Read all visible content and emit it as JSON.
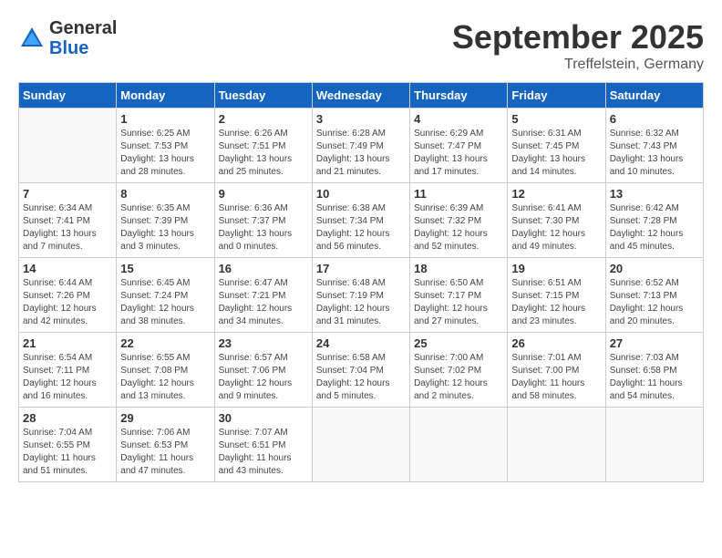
{
  "header": {
    "logo": {
      "general": "General",
      "blue": "Blue"
    },
    "title": "September 2025",
    "subtitle": "Treffelstein, Germany"
  },
  "days_of_week": [
    "Sunday",
    "Monday",
    "Tuesday",
    "Wednesday",
    "Thursday",
    "Friday",
    "Saturday"
  ],
  "weeks": [
    [
      {
        "day": "",
        "info": ""
      },
      {
        "day": "1",
        "info": "Sunrise: 6:25 AM\nSunset: 7:53 PM\nDaylight: 13 hours\nand 28 minutes."
      },
      {
        "day": "2",
        "info": "Sunrise: 6:26 AM\nSunset: 7:51 PM\nDaylight: 13 hours\nand 25 minutes."
      },
      {
        "day": "3",
        "info": "Sunrise: 6:28 AM\nSunset: 7:49 PM\nDaylight: 13 hours\nand 21 minutes."
      },
      {
        "day": "4",
        "info": "Sunrise: 6:29 AM\nSunset: 7:47 PM\nDaylight: 13 hours\nand 17 minutes."
      },
      {
        "day": "5",
        "info": "Sunrise: 6:31 AM\nSunset: 7:45 PM\nDaylight: 13 hours\nand 14 minutes."
      },
      {
        "day": "6",
        "info": "Sunrise: 6:32 AM\nSunset: 7:43 PM\nDaylight: 13 hours\nand 10 minutes."
      }
    ],
    [
      {
        "day": "7",
        "info": "Sunrise: 6:34 AM\nSunset: 7:41 PM\nDaylight: 13 hours\nand 7 minutes."
      },
      {
        "day": "8",
        "info": "Sunrise: 6:35 AM\nSunset: 7:39 PM\nDaylight: 13 hours\nand 3 minutes."
      },
      {
        "day": "9",
        "info": "Sunrise: 6:36 AM\nSunset: 7:37 PM\nDaylight: 13 hours\nand 0 minutes."
      },
      {
        "day": "10",
        "info": "Sunrise: 6:38 AM\nSunset: 7:34 PM\nDaylight: 12 hours\nand 56 minutes."
      },
      {
        "day": "11",
        "info": "Sunrise: 6:39 AM\nSunset: 7:32 PM\nDaylight: 12 hours\nand 52 minutes."
      },
      {
        "day": "12",
        "info": "Sunrise: 6:41 AM\nSunset: 7:30 PM\nDaylight: 12 hours\nand 49 minutes."
      },
      {
        "day": "13",
        "info": "Sunrise: 6:42 AM\nSunset: 7:28 PM\nDaylight: 12 hours\nand 45 minutes."
      }
    ],
    [
      {
        "day": "14",
        "info": "Sunrise: 6:44 AM\nSunset: 7:26 PM\nDaylight: 12 hours\nand 42 minutes."
      },
      {
        "day": "15",
        "info": "Sunrise: 6:45 AM\nSunset: 7:24 PM\nDaylight: 12 hours\nand 38 minutes."
      },
      {
        "day": "16",
        "info": "Sunrise: 6:47 AM\nSunset: 7:21 PM\nDaylight: 12 hours\nand 34 minutes."
      },
      {
        "day": "17",
        "info": "Sunrise: 6:48 AM\nSunset: 7:19 PM\nDaylight: 12 hours\nand 31 minutes."
      },
      {
        "day": "18",
        "info": "Sunrise: 6:50 AM\nSunset: 7:17 PM\nDaylight: 12 hours\nand 27 minutes."
      },
      {
        "day": "19",
        "info": "Sunrise: 6:51 AM\nSunset: 7:15 PM\nDaylight: 12 hours\nand 23 minutes."
      },
      {
        "day": "20",
        "info": "Sunrise: 6:52 AM\nSunset: 7:13 PM\nDaylight: 12 hours\nand 20 minutes."
      }
    ],
    [
      {
        "day": "21",
        "info": "Sunrise: 6:54 AM\nSunset: 7:11 PM\nDaylight: 12 hours\nand 16 minutes."
      },
      {
        "day": "22",
        "info": "Sunrise: 6:55 AM\nSunset: 7:08 PM\nDaylight: 12 hours\nand 13 minutes."
      },
      {
        "day": "23",
        "info": "Sunrise: 6:57 AM\nSunset: 7:06 PM\nDaylight: 12 hours\nand 9 minutes."
      },
      {
        "day": "24",
        "info": "Sunrise: 6:58 AM\nSunset: 7:04 PM\nDaylight: 12 hours\nand 5 minutes."
      },
      {
        "day": "25",
        "info": "Sunrise: 7:00 AM\nSunset: 7:02 PM\nDaylight: 12 hours\nand 2 minutes."
      },
      {
        "day": "26",
        "info": "Sunrise: 7:01 AM\nSunset: 7:00 PM\nDaylight: 11 hours\nand 58 minutes."
      },
      {
        "day": "27",
        "info": "Sunrise: 7:03 AM\nSunset: 6:58 PM\nDaylight: 11 hours\nand 54 minutes."
      }
    ],
    [
      {
        "day": "28",
        "info": "Sunrise: 7:04 AM\nSunset: 6:55 PM\nDaylight: 11 hours\nand 51 minutes."
      },
      {
        "day": "29",
        "info": "Sunrise: 7:06 AM\nSunset: 6:53 PM\nDaylight: 11 hours\nand 47 minutes."
      },
      {
        "day": "30",
        "info": "Sunrise: 7:07 AM\nSunset: 6:51 PM\nDaylight: 11 hours\nand 43 minutes."
      },
      {
        "day": "",
        "info": ""
      },
      {
        "day": "",
        "info": ""
      },
      {
        "day": "",
        "info": ""
      },
      {
        "day": "",
        "info": ""
      }
    ]
  ]
}
